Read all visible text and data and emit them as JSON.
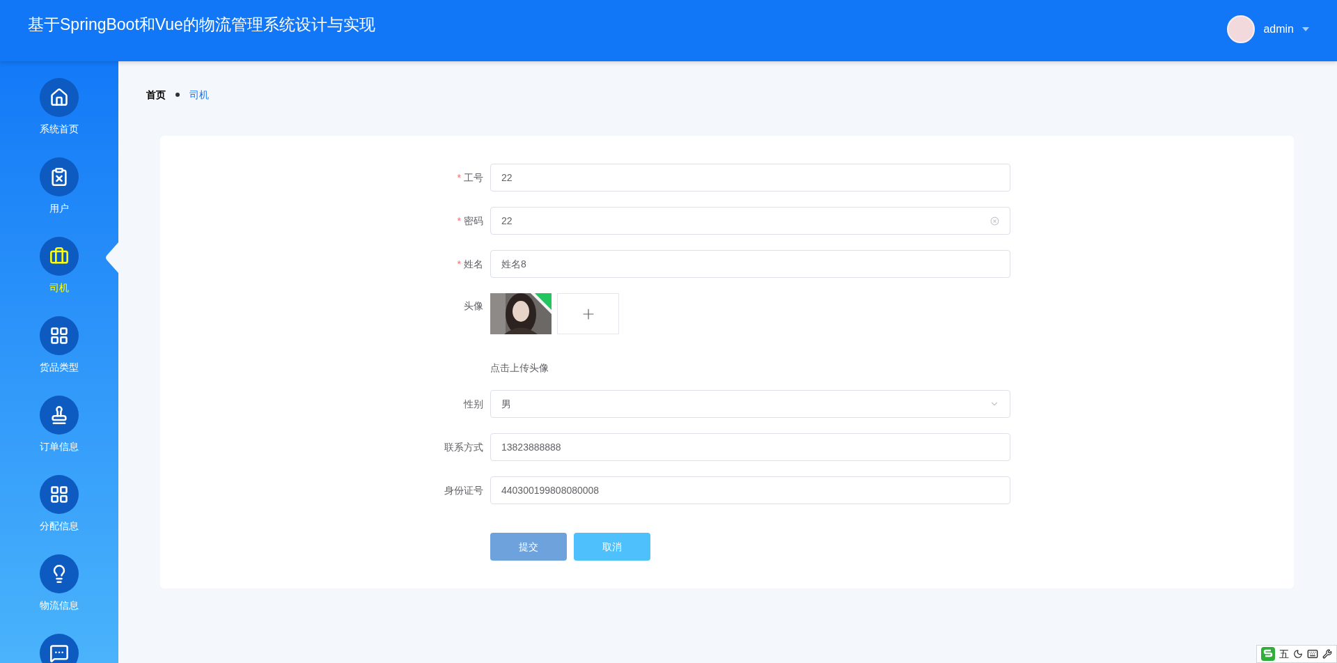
{
  "header": {
    "title": "基于SpringBoot和Vue的物流管理系统设计与实现",
    "user": "admin"
  },
  "sidebar": {
    "items": [
      {
        "label": "系统首页",
        "selected": false
      },
      {
        "label": "用户",
        "selected": false
      },
      {
        "label": "司机",
        "selected": true
      },
      {
        "label": "货品类型",
        "selected": false
      },
      {
        "label": "订单信息",
        "selected": false
      },
      {
        "label": "分配信息",
        "selected": false
      },
      {
        "label": "物流信息",
        "selected": false
      },
      {
        "selected": false
      }
    ]
  },
  "breadcrumb": [
    {
      "label": "首页",
      "current": false
    },
    {
      "label": "司机",
      "current": true
    }
  ],
  "form": {
    "fields": [
      {
        "kind": "text",
        "required_mark": "*",
        "label": "工号",
        "value": "22"
      },
      {
        "kind": "clearable",
        "required_mark": "*",
        "label": "密码",
        "value": "22"
      },
      {
        "kind": "text",
        "required_mark": "*",
        "label": "姓名",
        "value": "姓名8"
      },
      {
        "kind": "upload",
        "label": "头像",
        "hint": "点击上传头像"
      },
      {
        "kind": "select",
        "label": "性别",
        "value": "男"
      },
      {
        "kind": "text",
        "label": "联系方式",
        "value": "13823888888"
      },
      {
        "kind": "text",
        "label": "身份证号",
        "value": "440300199808080008"
      }
    ],
    "buttons": [
      {
        "kind": "primary",
        "label": "提交"
      },
      {
        "kind": "secondary",
        "label": "取消"
      }
    ]
  },
  "ime": {
    "mode": "五"
  }
}
